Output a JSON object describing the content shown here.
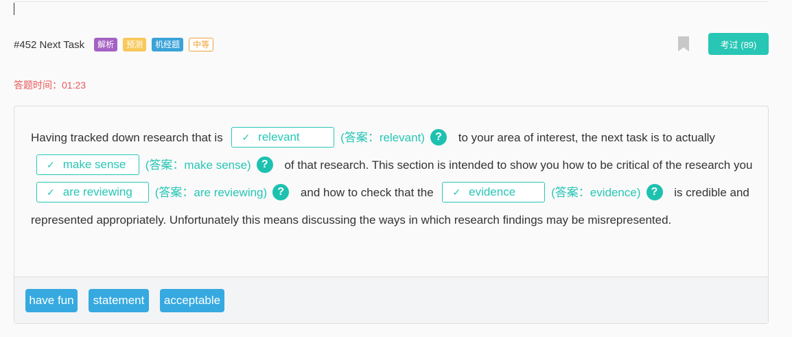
{
  "header": {
    "task_title": "#452 Next Task",
    "tags": [
      "解析",
      "预测",
      "机经题",
      "中等"
    ],
    "pass_button": "考过 (89)"
  },
  "timer": "答题时间：01:23",
  "passage": {
    "seg1": "Having tracked down research that is",
    "blank1": "relevant",
    "answer1": "(答案：relevant)",
    "seg2": "to your area of interest, the next task is to actually",
    "blank2": "make sense",
    "answer2": "(答案：make sense)",
    "seg3": "of that research. This section is intended to show you how to be critical of the research you",
    "blank3": "are reviewing",
    "answer3": "(答案：are reviewing)",
    "seg4": "and how to check that the",
    "blank4": "evidence",
    "answer4": "(答案：evidence)",
    "seg5": "is credible and represented appropriately. Unfortunately this means discussing the ways in which research findings may be misrepresented.",
    "check_mark": "✓",
    "help_symbol": "?"
  },
  "word_bank": [
    "have fun",
    "statement",
    "acceptable"
  ]
}
